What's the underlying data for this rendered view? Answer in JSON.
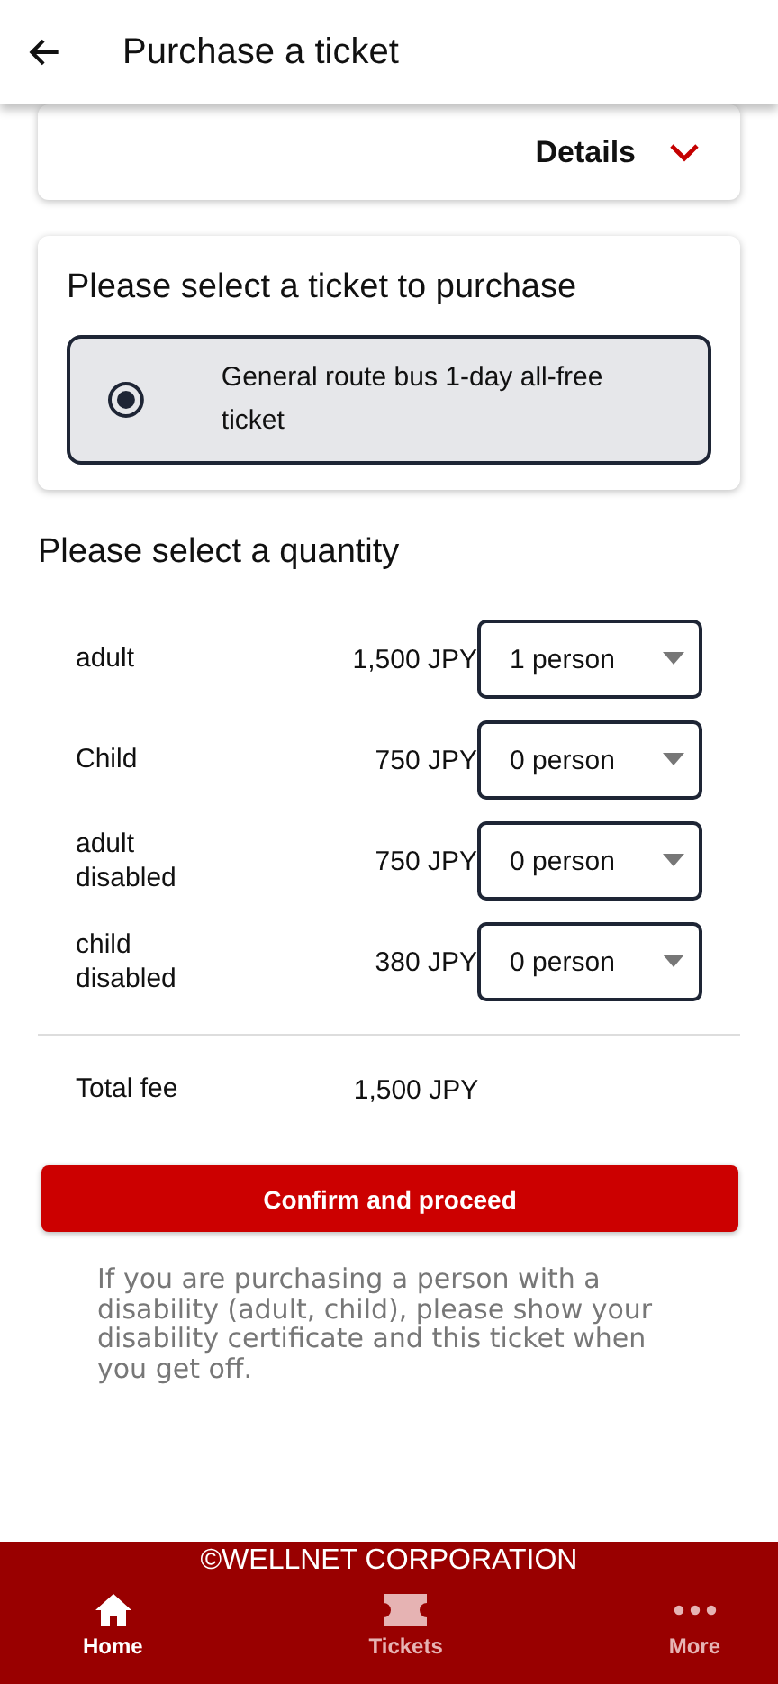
{
  "header": {
    "title": "Purchase a ticket"
  },
  "details": {
    "label": "Details",
    "expanded": false
  },
  "ticket_select": {
    "title": "Please select a ticket to purchase",
    "options": [
      {
        "label": "General route bus 1-day all-free ticket",
        "selected": true
      }
    ]
  },
  "quantity": {
    "title": "Please select a quantity",
    "rows": [
      {
        "label": "adult",
        "price": "1,500 JPY",
        "value": "1 person"
      },
      {
        "label": "Child",
        "price": "750 JPY",
        "value": "0 person"
      },
      {
        "label": "adult disabled",
        "price": "750 JPY",
        "value": "0 person"
      },
      {
        "label": "child disabled",
        "price": "380 JPY",
        "value": "0 person"
      }
    ],
    "total_label": "Total fee",
    "total": "1,500 JPY"
  },
  "confirm_button": "Confirm and proceed",
  "note": "If you are purchasing a person with a disability (adult, child), please show your disability certificate and this ticket when you get off.",
  "footer": {
    "copyright": "©WELLNET CORPORATION",
    "nav": [
      {
        "label": "Home",
        "selected": true
      },
      {
        "label": "Tickets",
        "selected": false
      },
      {
        "label": "More",
        "selected": false
      }
    ]
  }
}
